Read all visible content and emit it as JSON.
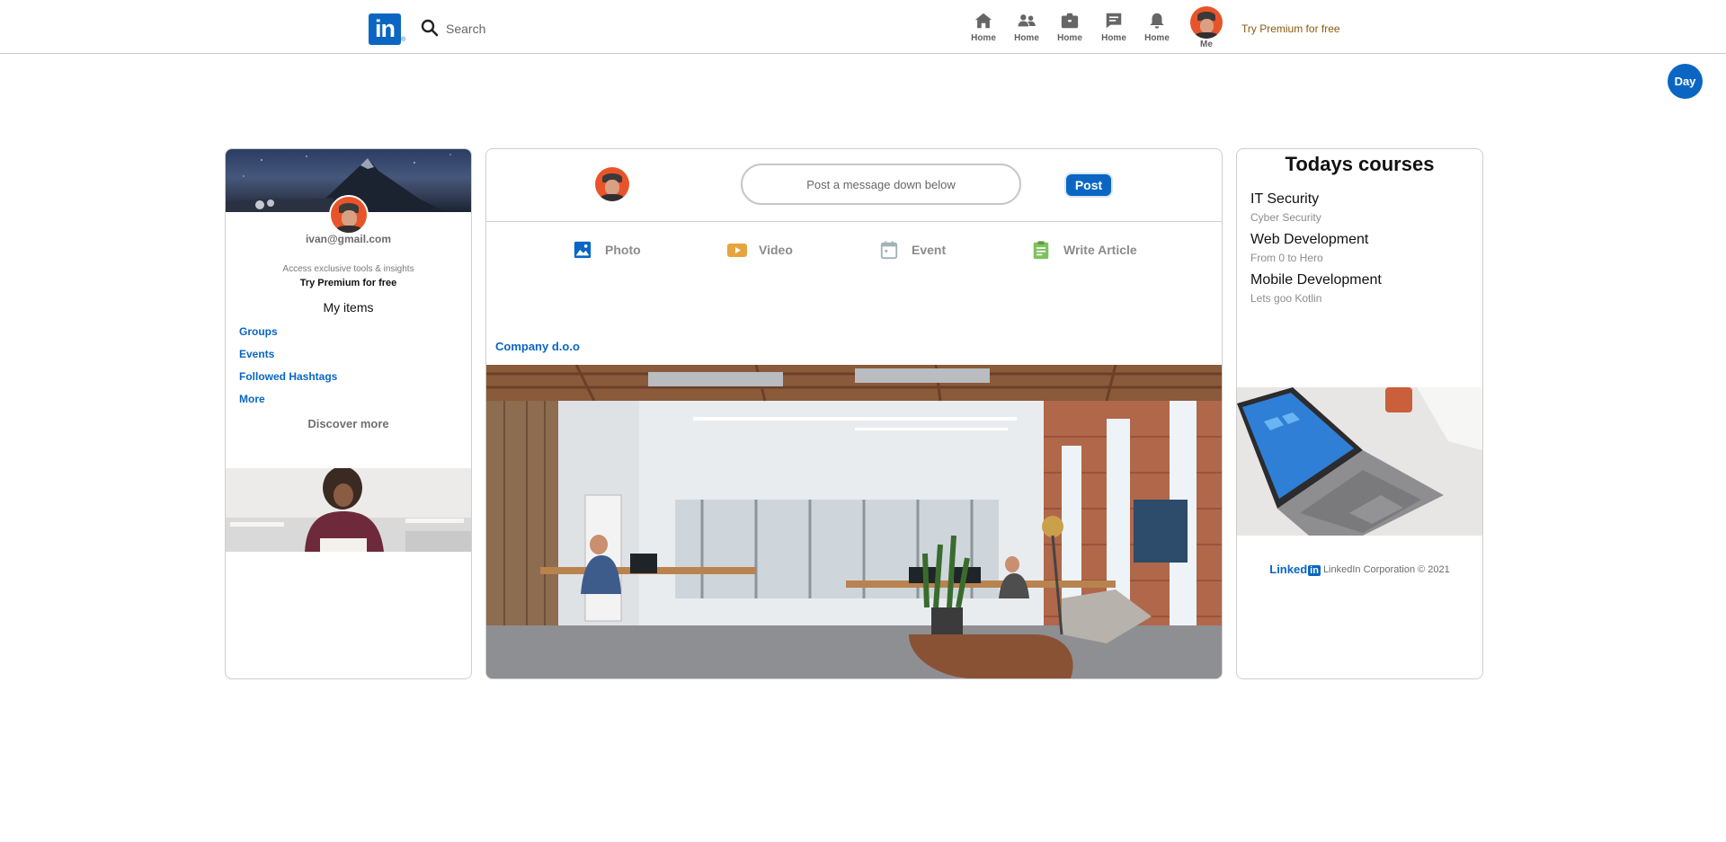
{
  "nav": {
    "logo": "in",
    "logo_tm": "®",
    "search_placeholder": "Search",
    "items": [
      {
        "label": "Home",
        "icon": "home-icon"
      },
      {
        "label": "Home",
        "icon": "network-icon"
      },
      {
        "label": "Home",
        "icon": "briefcase-icon"
      },
      {
        "label": "Home",
        "icon": "messaging-icon"
      },
      {
        "label": "Home",
        "icon": "bell-icon"
      }
    ],
    "me_label": "Me",
    "premium": "Try Premium for free"
  },
  "theme_toggle": "Day",
  "profile": {
    "email": "ivan@gmail.com",
    "access_text": "Access exclusive tools & insights",
    "premium": "Try Premium for free",
    "my_items": "My items",
    "links": [
      "Groups",
      "Events",
      "Followed Hashtags",
      "More"
    ],
    "discover": "Discover more"
  },
  "share": {
    "placeholder": "Post a message down below",
    "post_button": "Post",
    "actions": [
      {
        "label": "Photo",
        "icon": "photo-icon",
        "color": "#0a66c2"
      },
      {
        "label": "Video",
        "icon": "video-icon",
        "color": "#e7a33e"
      },
      {
        "label": "Event",
        "icon": "calendar-icon",
        "color": "#a0b4b7"
      },
      {
        "label": "Write Article",
        "icon": "article-icon",
        "color": "#7fc15e"
      }
    ]
  },
  "post": {
    "company": "Company d.o.o"
  },
  "courses": {
    "title": "Todays courses",
    "items": [
      {
        "name": "IT Security",
        "sub": "Cyber Security"
      },
      {
        "name": "Web Development",
        "sub": "From 0 to Hero"
      },
      {
        "name": "Mobile Development",
        "sub": "Lets goo Kotlin"
      }
    ]
  },
  "footer": {
    "logo_text": "Linked",
    "logo_in": "in",
    "text": "LinkedIn Corporation © 2021"
  },
  "colors": {
    "brand": "#0a66c2",
    "premium": "#8a5a0b"
  }
}
